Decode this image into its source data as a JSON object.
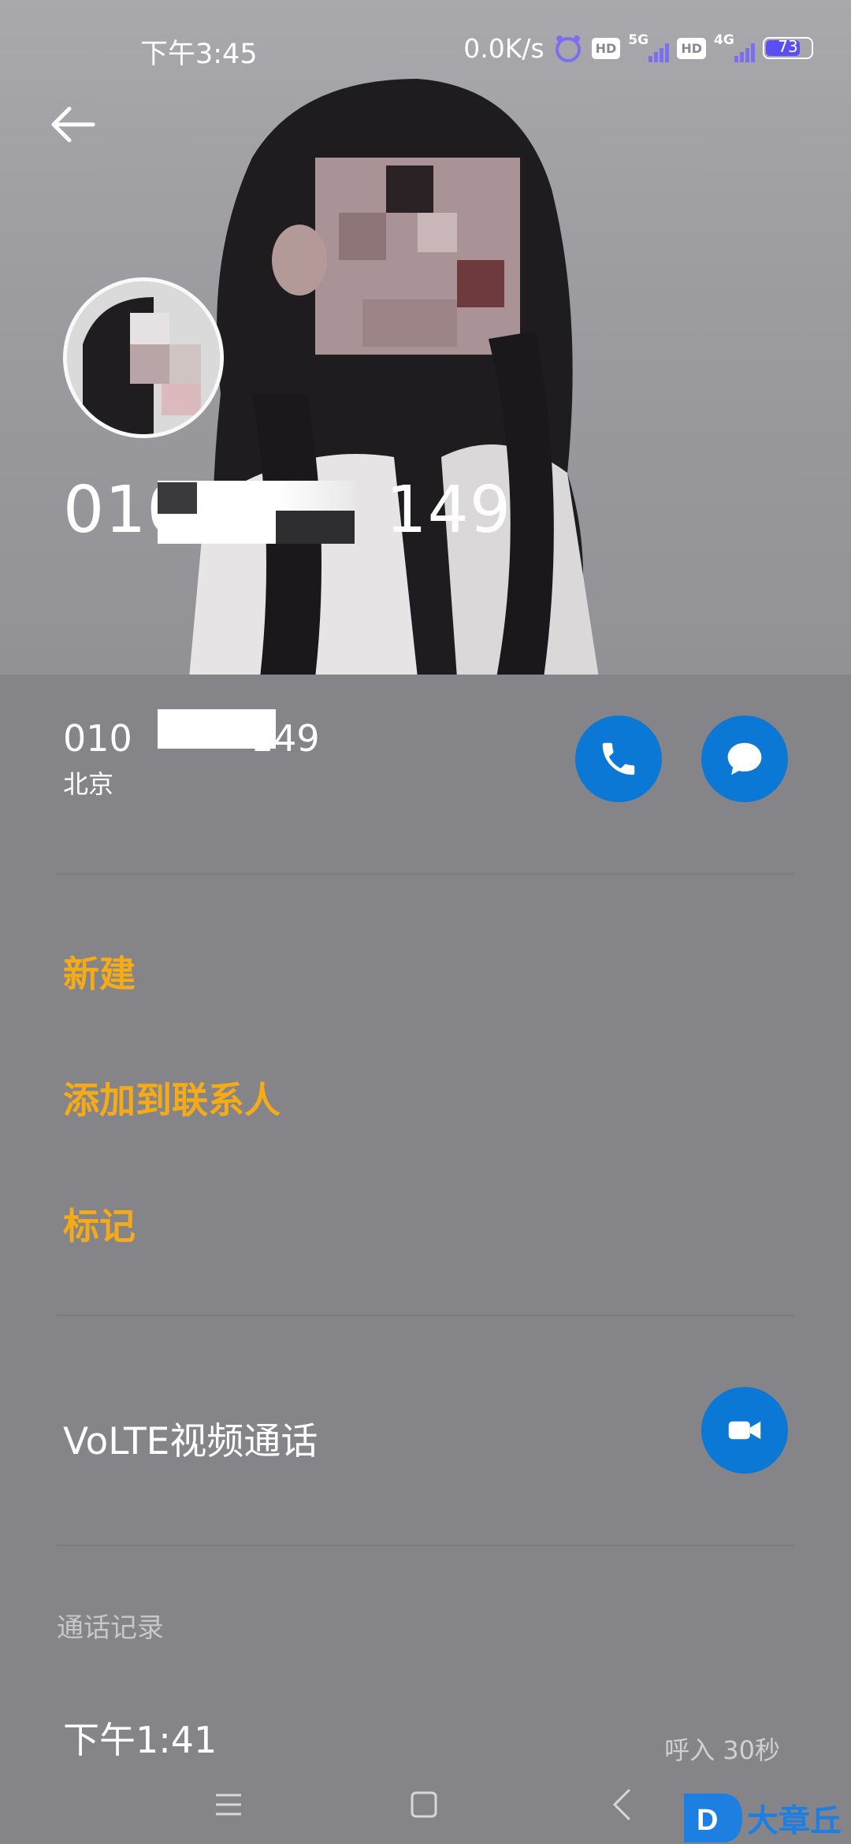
{
  "status_bar": {
    "time": "下午3:45",
    "net_speed": "0.0K/s",
    "hd1": "HD",
    "net1": "5G",
    "hd2": "HD",
    "net2": "4G",
    "battery": "73",
    "icons": [
      "alarm-icon",
      "signal-icon",
      "signal-icon",
      "battery-icon"
    ]
  },
  "header": {
    "back_icon": "back-arrow-icon",
    "hero_number": "010",
    "hero_number_tail": "149"
  },
  "contact": {
    "number_head": "010",
    "number_tail": "149",
    "location": "北京",
    "call_icon": "phone-icon",
    "message_icon": "message-icon"
  },
  "actions": {
    "new": "新建",
    "add_to_contacts": "添加到联系人",
    "mark": "标记"
  },
  "video_call": {
    "label": "VoLTE视频通话",
    "icon": "video-camera-icon"
  },
  "call_log": {
    "section_title": "通话记录",
    "entries": [
      {
        "time": "下午1:41",
        "detail": "呼入 30秒"
      }
    ]
  },
  "navigation": {
    "icons": [
      "menu-icon",
      "home-square-icon",
      "back-chevron-icon"
    ]
  },
  "watermark": {
    "text": "大章丘"
  },
  "colors": {
    "accent_orange": "#f5ab18",
    "action_blue": "#0a78d4",
    "panel_gray": "#858589"
  }
}
